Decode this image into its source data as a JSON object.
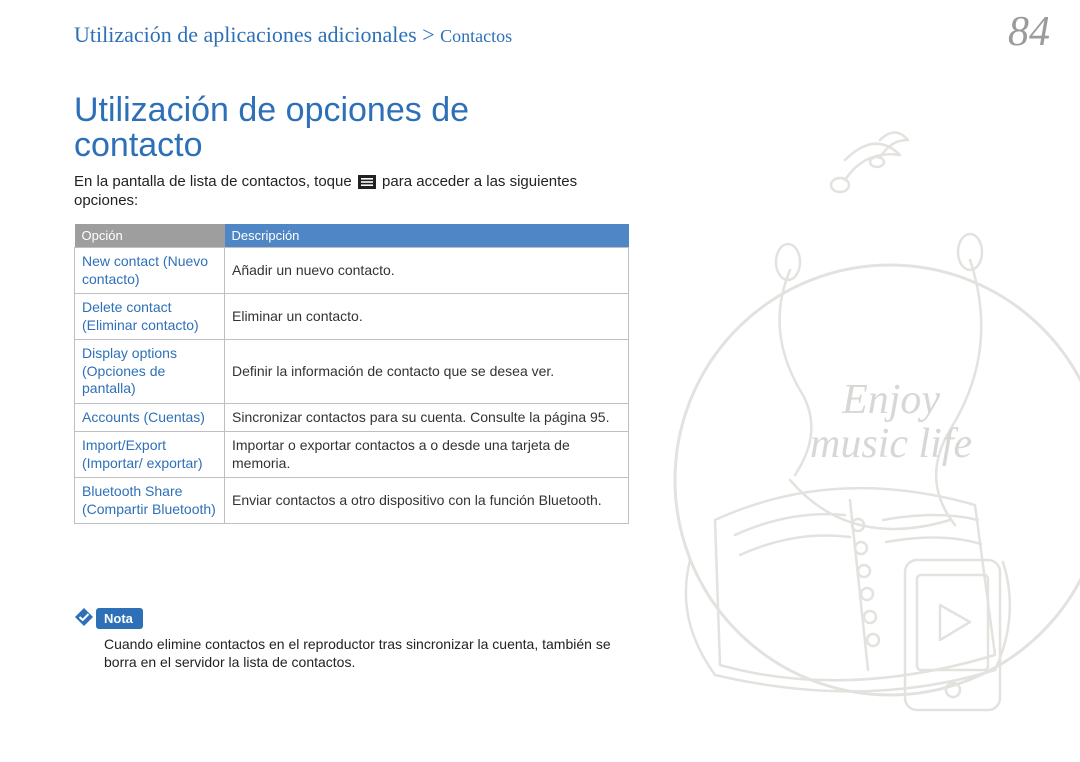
{
  "breadcrumb": {
    "section": "Utilización de aplicaciones adicionales",
    "sep": " > ",
    "page": "Contactos"
  },
  "page_number": "84",
  "heading_html": "Utilización de opciones de<br>contacto",
  "intro_before": "En la pantalla de lista de contactos, toque ",
  "intro_after": " para acceder a las siguientes opciones:",
  "table": {
    "head_option": "Opción",
    "head_desc": "Descripción",
    "rows": [
      {
        "opt": "New contact (Nuevo contacto)",
        "desc": "Añadir un nuevo contacto."
      },
      {
        "opt": "Delete contact (Eliminar contacto)",
        "desc": "Eliminar un contacto."
      },
      {
        "opt": "Display options (Opciones de pantalla)",
        "desc": "Definir la información de contacto que se desea ver."
      },
      {
        "opt": "Accounts (Cuentas)",
        "desc": "Sincronizar contactos para su cuenta. Consulte la página 95."
      },
      {
        "opt": "Import/Export (Importar/ exportar)",
        "desc": "Importar o exportar contactos a o desde una tarjeta de memoria."
      },
      {
        "opt": "Bluetooth Share (Compartir Bluetooth)",
        "desc": "Enviar contactos a otro dispositivo con la función Bluetooth."
      }
    ]
  },
  "note": {
    "label": "Nota",
    "text": "Cuando elimine contactos en el reproductor tras sincronizar la cuenta, también se borra en el servidor la lista de contactos."
  },
  "illustration_caption": "Enjoy\nmusic life",
  "icons": {
    "menu": "menu-icon",
    "music_note": "music-note-icon",
    "earphones": "earphones-icon",
    "notebook": "notebook-icon",
    "player": "media-player-icon"
  },
  "chart_data": {
    "type": "table",
    "title": "Utilización de opciones de contacto",
    "columns": [
      "Opción",
      "Descripción"
    ],
    "rows": [
      [
        "New contact (Nuevo contacto)",
        "Añadir un nuevo contacto."
      ],
      [
        "Delete contact (Eliminar contacto)",
        "Eliminar un contacto."
      ],
      [
        "Display options (Opciones de pantalla)",
        "Definir la información de contacto que se desea ver."
      ],
      [
        "Accounts (Cuentas)",
        "Sincronizar contactos para su cuenta. Consulte la página 95."
      ],
      [
        "Import/Export (Importar/exportar)",
        "Importar o exportar contactos a o desde una tarjeta de memoria."
      ],
      [
        "Bluetooth Share (Compartir Bluetooth)",
        "Enviar contactos a otro dispositivo con la función Bluetooth."
      ]
    ]
  }
}
